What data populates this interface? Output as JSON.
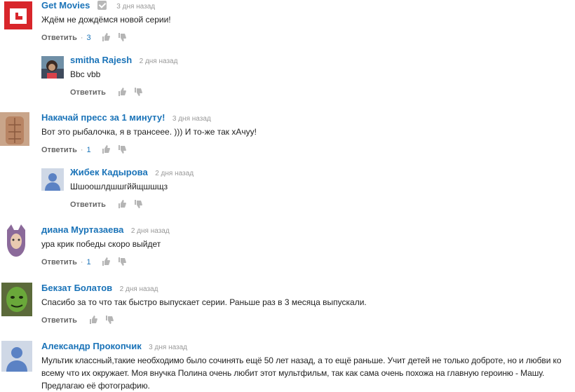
{
  "actions": {
    "reply_label": "Ответить"
  },
  "comments": [
    {
      "author": "Get Movies",
      "time": "3 дня назад",
      "text": "Ждём не дождёмся новой серии!",
      "likes": "3"
    },
    {
      "author": "smitha Rajesh",
      "time": "2 дня назад",
      "text": "Bbc vbb"
    },
    {
      "author": "Накачай пресс за 1 минуту!",
      "time": "3 дня назад",
      "text": "Вот это рыбалочка, я в трансеее. ))) И то-же так хАчуу!",
      "likes": "1"
    },
    {
      "author": "Жибек Кадырова",
      "time": "2 дня назад",
      "text": "Шшоошлдшшгййщшшщз"
    },
    {
      "author": "диана Муртазаева",
      "time": "2 дня назад",
      "text": "ура крик победы скоро выйдет",
      "likes": "1"
    },
    {
      "author": "Бекзат Болатов",
      "time": "2 дня назад",
      "text": "Спасибо за то что так быстро выпускает серии. Раньше раз в 3 месяца выпускали."
    },
    {
      "author": "Александр Прокопчик",
      "time": "3 дня назад",
      "text": "Мультик классный,такие необходимо было сочинять ещё 50 лет назад, а то ещё раньше. Учит детей не только доброте, но и любви ко всему что их окружает. Моя внучка Полина очень любит этот мультфильм, так как сама очень похожа на главную героиню - Машу. Предлагаю её фотографию."
    }
  ]
}
